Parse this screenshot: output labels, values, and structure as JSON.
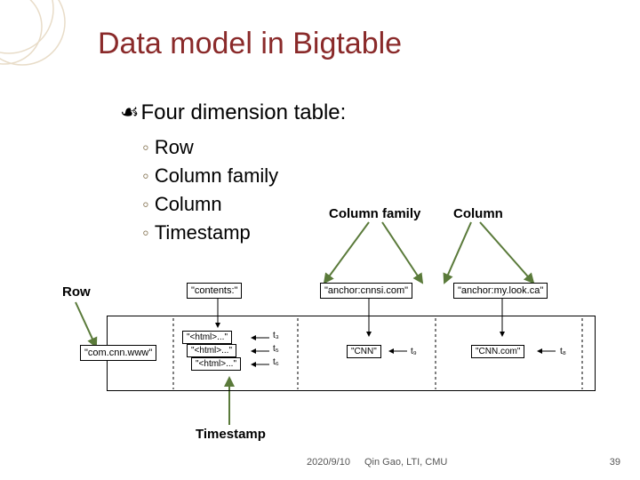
{
  "title": "Data model in Bigtable",
  "main_bullet": "Four dimension table:",
  "sub_items": [
    "Row",
    "Column family",
    "Column",
    "Timestamp"
  ],
  "labels": {
    "column_family": "Column family",
    "column": "Column",
    "row": "Row",
    "timestamp": "Timestamp"
  },
  "diagram": {
    "headers": {
      "contents": "\"contents:\"",
      "anchor_cnnsi": "\"anchor:cnnsi.com\"",
      "anchor_mylook": "\"anchor:my.look.ca\""
    },
    "row_key": "\"com.cnn.www\"",
    "cells": {
      "html1": "\"<html>...\"",
      "html2": "\"<html>...\"",
      "html3": "\"<html>...\"",
      "cnn": "\"CNN\"",
      "cnn_com": "\"CNN.com\""
    },
    "timestamps": {
      "t3": "t₃",
      "t5": "t₅",
      "t6": "t₆",
      "t8": "t₈",
      "t9": "t₉"
    }
  },
  "footer": {
    "date": "2020/9/10",
    "author": "Qin Gao, LTI, CMU",
    "page": "39"
  }
}
